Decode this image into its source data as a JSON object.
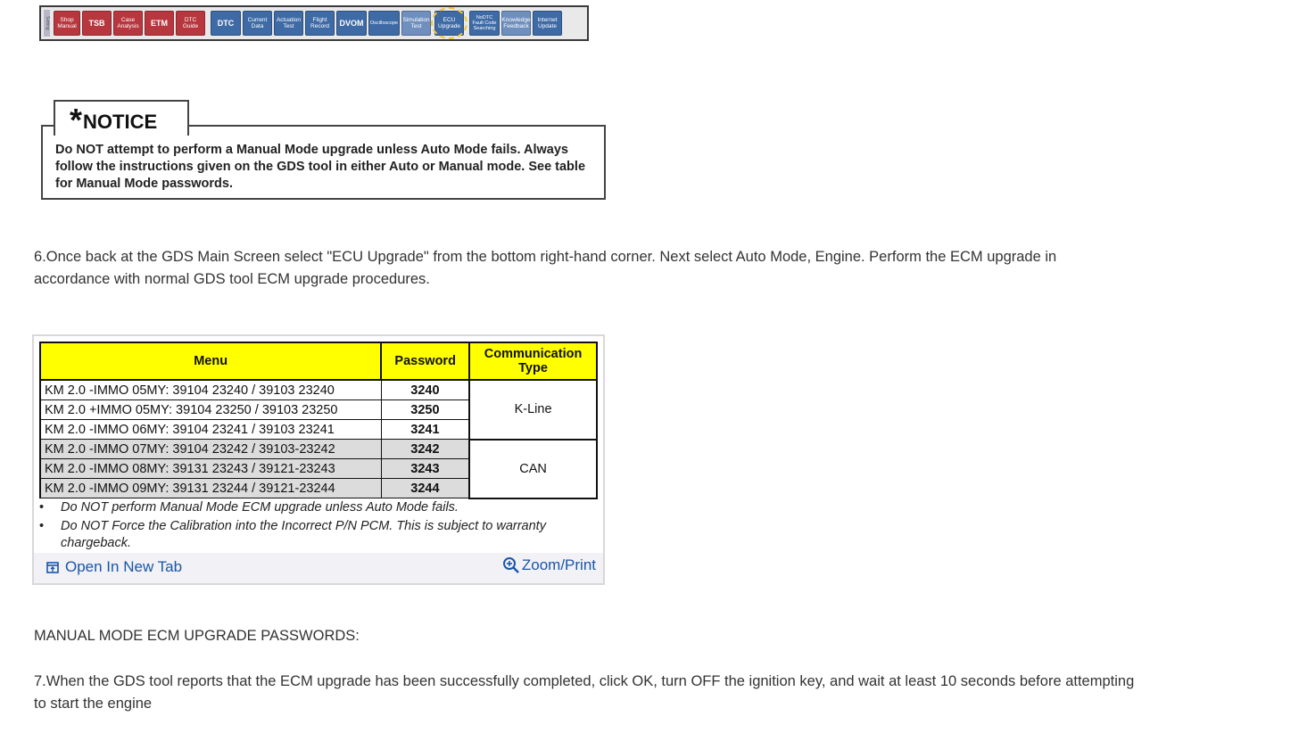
{
  "toolbar": {
    "side_label": "Setting",
    "buttons": [
      {
        "label": "Shop\nManual",
        "style": "red"
      },
      {
        "label": "TSB",
        "style": "red"
      },
      {
        "label": "Case\nAnalysis",
        "style": "red"
      },
      {
        "label": "ETM",
        "style": "red"
      },
      {
        "label": "DTC\nGuide",
        "style": "red"
      },
      {
        "label": "DTC",
        "style": "blue"
      },
      {
        "label": "Current\nData",
        "style": "blue"
      },
      {
        "label": "Actuation\nTest",
        "style": "blue"
      },
      {
        "label": "Flight\nRecord",
        "style": "blue"
      },
      {
        "label": "DVOM",
        "style": "blue"
      },
      {
        "label": "Oscilloscope",
        "style": "blue"
      },
      {
        "label": "Simulation\nTest",
        "style": "blue-light"
      },
      {
        "label": "ECU\nUpgrade",
        "style": "blue",
        "highlight": true
      },
      {
        "label": "NoDTC\nFault Code\nSearching",
        "style": "blue"
      },
      {
        "label": "Knowledge\nFeedback",
        "style": "blue-light"
      },
      {
        "label": "Internet\nUpdate",
        "style": "blue"
      }
    ]
  },
  "notice": {
    "star": "*",
    "heading": "NOTICE",
    "text": "Do NOT attempt to perform a Manual Mode upgrade unless Auto Mode fails. Always follow the instructions given on the GDS tool in either Auto or Manual mode. See table for Manual Mode passwords."
  },
  "step6": "6.Once back at the GDS Main Screen select \"ECU Upgrade\" from the bottom right-hand corner. Next select Auto Mode, Engine. Perform the ECM upgrade in accordance with normal GDS tool ECM upgrade procedures.",
  "table": {
    "headers": {
      "menu": "Menu",
      "password": "Password",
      "comm": "Communication Type"
    },
    "rows": [
      {
        "menu": "KM 2.0 -IMMO 05MY: 39104 23240 / 39103 23240",
        "password": "3240"
      },
      {
        "menu": "KM 2.0 +IMMO 05MY: 39104 23250 / 39103 23250",
        "password": "3250"
      },
      {
        "menu": "KM 2.0 -IMMO 06MY: 39104 23241 / 39103 23241",
        "password": "3241"
      },
      {
        "menu": "KM 2.0 -IMMO 07MY: 39104 23242 / 39103-23242",
        "password": "3242"
      },
      {
        "menu": "KM 2.0 -IMMO 08MY: 39131 23243 / 39121-23243",
        "password": "3243"
      },
      {
        "menu": "KM 2.0 -IMMO 09MY: 39131 23244 / 39121-23244",
        "password": "3244"
      }
    ],
    "comm_groups": [
      "K-Line",
      "CAN"
    ],
    "notes": [
      "Do NOT perform Manual Mode ECM upgrade unless Auto Mode fails.",
      "Do NOT Force the Calibration into the Incorrect P/N PCM. This is subject to warranty chargeback."
    ],
    "bullet": "•",
    "open_tab_label": "Open In New Tab",
    "zoom_label": "Zoom/Print"
  },
  "manual_heading": "MANUAL MODE ECM UPGRADE PASSWORDS:",
  "step7": "7.When the GDS tool reports that the ECM upgrade has been successfully completed, click OK, turn OFF the ignition key, and wait at least 10 seconds before attempting to start the engine",
  "colors": {
    "table_header": "#ffff00",
    "link": "#1a56a8",
    "highlight": "#f3c62f"
  }
}
